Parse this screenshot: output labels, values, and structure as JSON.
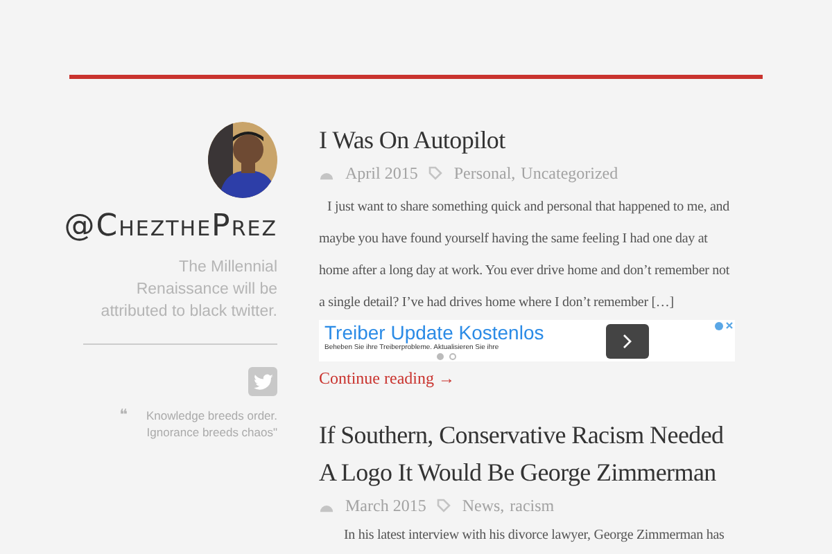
{
  "sidebar": {
    "handle": "@ChezthePrez",
    "tagline": "The Millennial Renaissance will be attributed to black twitter.",
    "quote_mark": "❝",
    "quote": "Knowledge breeds order. Ignorance breeds chaos\""
  },
  "posts": [
    {
      "title": "I Was On Autopilot",
      "date": "April 2015",
      "categories": [
        "Personal,",
        "Uncategorized"
      ],
      "excerpt": "I just want to share something quick and personal that happened to me, and maybe you have found yourself having the same feeling I had one day at home after a long day at work. You ever drive home and don’t remember not a single detail?  I’ve had drives home where I don’t remember […]",
      "ad": {
        "title": "Treiber Update Kostenlos",
        "subtitle": "Beheben Sie ihre Treiberprobleme. Aktualisieren Sie ihre",
        "dots": [
          {
            "selected": true
          },
          {
            "selected": false
          }
        ]
      },
      "more": "Continue reading →"
    },
    {
      "title": "If Southern, Conservative Racism Needed A Logo It Would Be George Zimmerman",
      "date": "March 2015",
      "categories": [
        "News,",
        "racism"
      ],
      "excerpt": "In his latest interview with his divorce lawyer, George Zimmerman has"
    }
  ]
}
